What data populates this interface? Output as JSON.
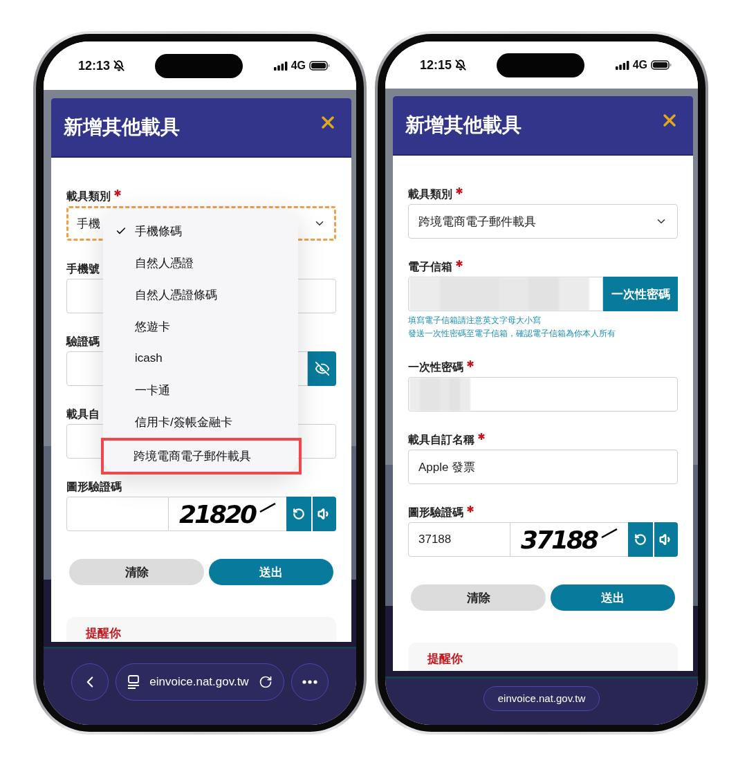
{
  "phones": [
    {
      "status_bar": {
        "time": "12:13",
        "network": "4G"
      },
      "dialog": {
        "title": "新增其他載具"
      },
      "fields": [
        {
          "kind": "select",
          "label": "載具類別",
          "required": true,
          "value": "手機",
          "focused": true
        },
        {
          "kind": "text",
          "label": "手機號"
        },
        {
          "kind": "secret",
          "label": "驗證碼"
        },
        {
          "kind": "text",
          "label": "載具自"
        },
        {
          "kind": "captcha",
          "label": "圖形驗證碼",
          "captcha": "21820"
        }
      ],
      "buttons": [
        {
          "kind": "secondary",
          "label": "清除"
        },
        {
          "kind": "primary",
          "label": "送出"
        }
      ],
      "notice": {
        "title": "提醒你"
      },
      "dropdown": {
        "options": [
          {
            "label": "手機條碼",
            "selected": true,
            "highlighted": false
          },
          {
            "label": "自然人憑證",
            "selected": false,
            "highlighted": false
          },
          {
            "label": "自然人憑證條碼",
            "selected": false,
            "highlighted": false
          },
          {
            "label": "悠遊卡",
            "selected": false,
            "highlighted": false
          },
          {
            "label": "icash",
            "selected": false,
            "highlighted": false
          },
          {
            "label": "一卡通",
            "selected": false,
            "highlighted": false
          },
          {
            "label": "信用卡/簽帳金融卡",
            "selected": false,
            "highlighted": false
          },
          {
            "label": "跨境電商電子郵件載具",
            "selected": false,
            "highlighted": true
          }
        ]
      },
      "browser_bar": {
        "kind": "full",
        "url": "einvoice.nat.gov.tw"
      }
    },
    {
      "status_bar": {
        "time": "12:15",
        "network": "4G"
      },
      "dialog": {
        "title": "新增其他載具"
      },
      "fields": [
        {
          "kind": "select",
          "label": "載具類別",
          "required": true,
          "value": "跨境電商電子郵件載具",
          "focused": false
        },
        {
          "kind": "email",
          "label": "電子信箱",
          "required": true,
          "redacted": true,
          "button": "一次性密碼",
          "hints": [
            "填寫電子信箱請注意英文字母大小寫",
            "發送一次性密碼至電子信箱，確認電子信箱為你本人所有"
          ]
        },
        {
          "kind": "text",
          "label": "一次性密碼",
          "required": true,
          "redacted": true
        },
        {
          "kind": "text",
          "label": "載具自訂名稱",
          "required": true,
          "value": "Apple 發票"
        },
        {
          "kind": "captcha",
          "label": "圖形驗證碼",
          "required": true,
          "value": "37188",
          "captcha": "37188"
        }
      ],
      "buttons": [
        {
          "kind": "secondary",
          "label": "清除"
        },
        {
          "kind": "primary",
          "label": "送出"
        }
      ],
      "notice": {
        "title": "提醒你"
      },
      "browser_bar": {
        "kind": "compact",
        "url": "einvoice.nat.gov.tw"
      }
    }
  ]
}
